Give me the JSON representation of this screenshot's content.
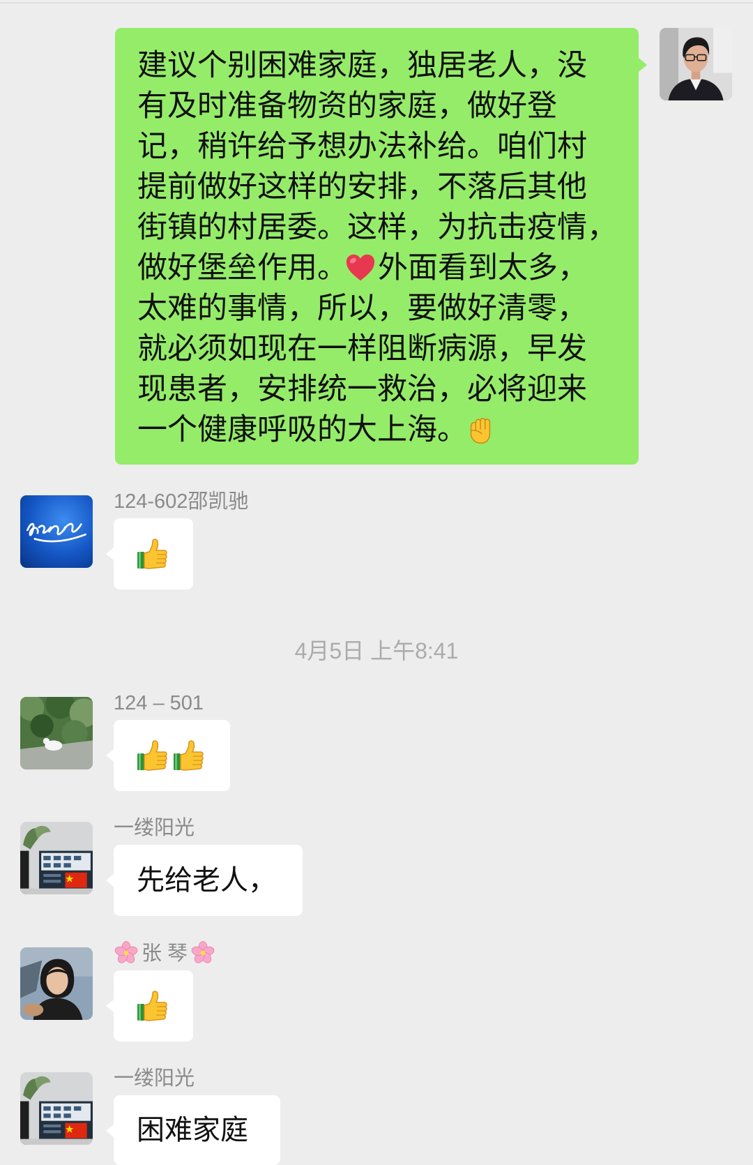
{
  "theme": {
    "background": "#ededed",
    "sent_bubble": "#95ec69",
    "received_bubble": "#ffffff",
    "sender_name": "#8a8a8a",
    "timestamp": "#ababab"
  },
  "sent_message": {
    "lines": [
      {
        "text": "建议个别困难家庭，独居老人，没"
      },
      {
        "text": "有及时准备物资的家庭，做好登"
      },
      {
        "text": "记，稍许给予想办法补给。咱们村"
      },
      {
        "text": "提前做好这样的安排，不落后其他"
      },
      {
        "text": "街镇的村居委。这样，为抗击疫情，"
      },
      {
        "text": "做好堡垒作用。",
        "emoji": "red-heart",
        "text_after": "外面看到太多，"
      },
      {
        "text": "太难的事情，所以，要做好清零，"
      },
      {
        "text": "就必须如现在一样阻断病源，早发"
      },
      {
        "text": "现患者，安排统一救治，必将迎来"
      },
      {
        "text": "一个健康呼吸的大上海。",
        "emoji": "raised-fist"
      }
    ]
  },
  "received_messages": [
    {
      "sender": "124-602邵凯驰",
      "emoji": [
        "thumbs-up"
      ]
    },
    {
      "sender": "124 – 501",
      "emoji": [
        "thumbs-up",
        "thumbs-up"
      ]
    },
    {
      "sender": "一缕阳光",
      "text": "先给老人，"
    },
    {
      "sender": "张 琴",
      "sender_emoji": "cherry-blossom",
      "emoji": [
        "thumbs-up"
      ]
    },
    {
      "sender": "一缕阳光",
      "text": "困难家庭"
    }
  ],
  "timestamp_divider": "4月5日 上午8:41"
}
